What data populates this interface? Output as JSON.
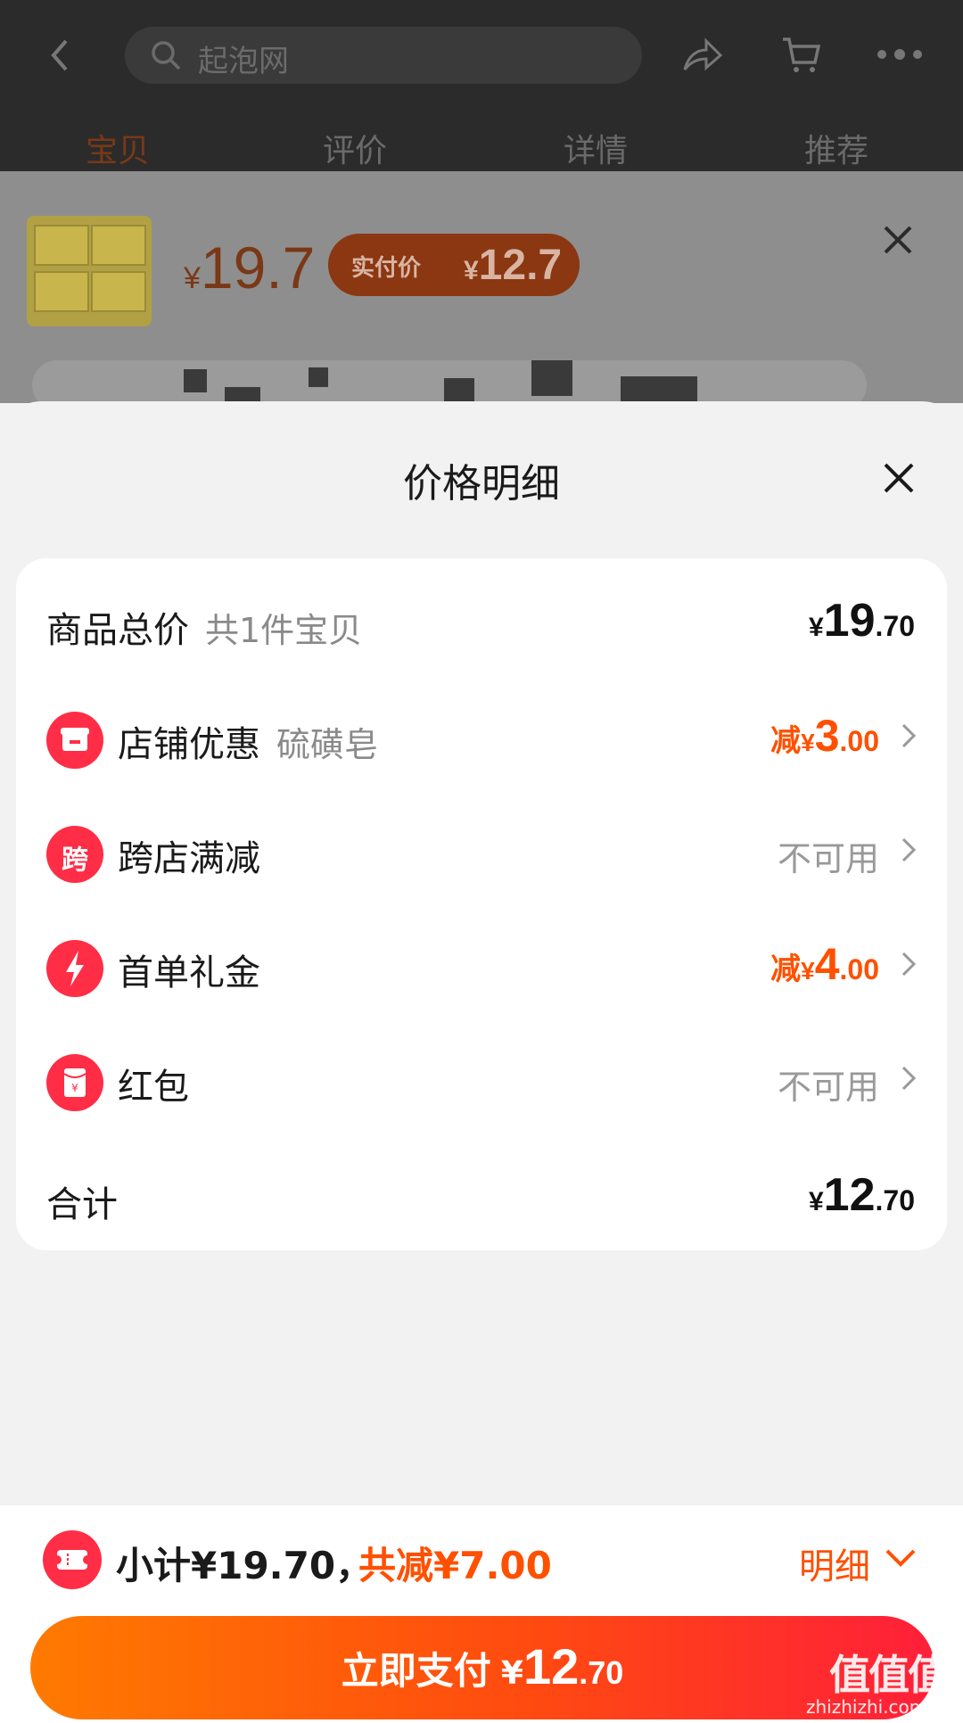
{
  "header": {
    "search_placeholder": "起泡网",
    "tabs": [
      "宝贝",
      "评价",
      "详情",
      "推荐"
    ]
  },
  "product": {
    "currency": "¥",
    "price": "19.7",
    "actual_label": "实付价",
    "actual_currency": "¥",
    "actual_price": "12.7"
  },
  "sheet": {
    "title": "价格明细",
    "rows": [
      {
        "label": "商品总价",
        "sub": "共1件宝贝",
        "currency": "¥",
        "int": "19",
        "dec": ".70"
      },
      {
        "label": "店铺优惠",
        "sub": "硫磺皂",
        "prefix": "减",
        "currency": "¥",
        "int": "3",
        "dec": ".00",
        "icon": "shop-icon"
      },
      {
        "label": "跨店满减",
        "status": "不可用",
        "icon_glyph": "跨",
        "icon": "cross-store-icon"
      },
      {
        "label": "首单礼金",
        "prefix": "减",
        "currency": "¥",
        "int": "4",
        "dec": ".00",
        "icon": "lightning-icon"
      },
      {
        "label": "红包",
        "status": "不可用",
        "icon": "red-packet-icon"
      },
      {
        "label": "合计",
        "currency": "¥",
        "int": "12",
        "dec": ".70"
      }
    ]
  },
  "bottom": {
    "subtotal": "小计¥19.70，",
    "savings": "共减¥7.00",
    "detail": "明细",
    "pay_label": "立即支付",
    "pay_currency": "¥",
    "pay_int": "12",
    "pay_dec": ".70"
  },
  "watermark": {
    "logo": "值值值",
    "url": "zhizhizhi.com"
  },
  "colors": {
    "accent": "#ff5000",
    "icon_red": "#ff2d45",
    "pay_start": "#ff7a00",
    "pay_end": "#ff1f3a"
  }
}
